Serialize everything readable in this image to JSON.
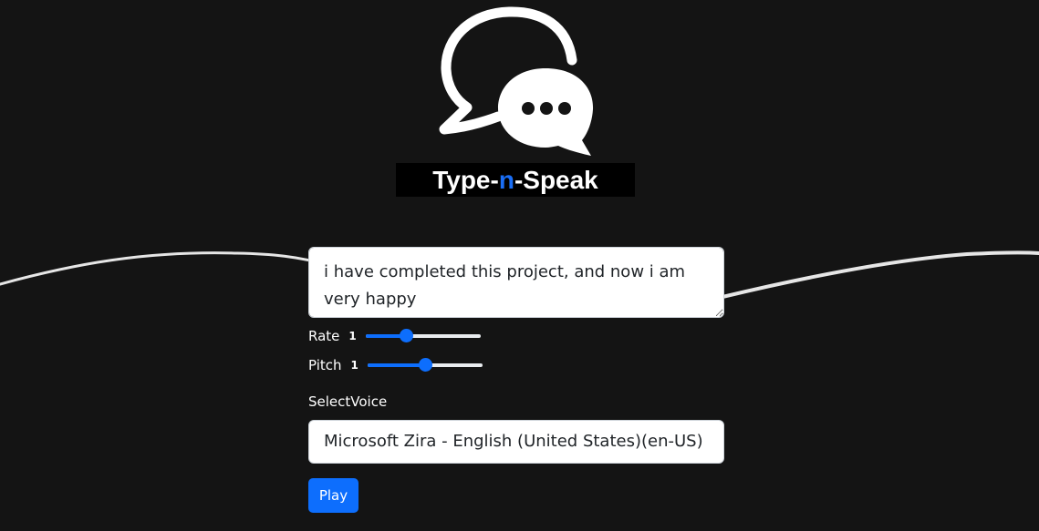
{
  "brand": {
    "prefix": "Type-",
    "accent": "n",
    "suffix": "-Speak",
    "accent_color": "#1a6ef5"
  },
  "logo": {
    "icon": "chat-bubbles-icon"
  },
  "text_input": {
    "value": "i have completed this project, and now i am very happy"
  },
  "controls": {
    "rate": {
      "label": "Rate",
      "value": "1",
      "level": 0.35
    },
    "pitch": {
      "label": "Pitch",
      "value": "1",
      "level": 0.5
    }
  },
  "voice": {
    "label": "SelectVoice",
    "selected": "Microsoft Zira - English (United States)(en-US)"
  },
  "play": {
    "label": "Play"
  },
  "colors": {
    "background": "#141414",
    "primary": "#0d6efd"
  }
}
